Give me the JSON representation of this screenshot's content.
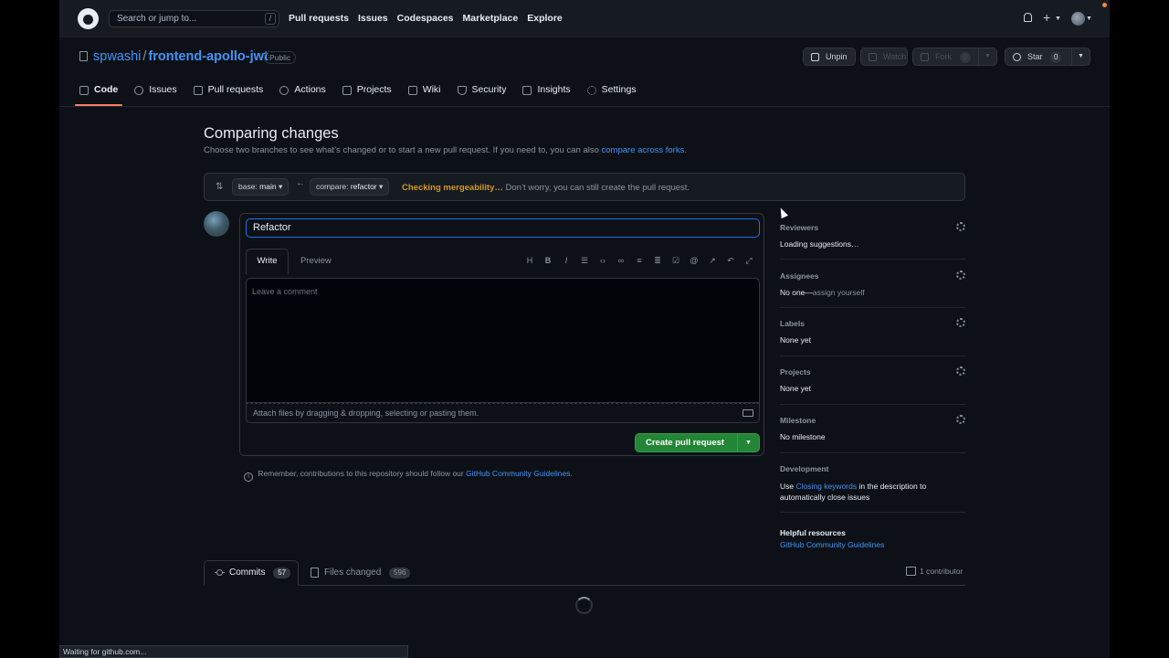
{
  "header": {
    "search_placeholder": "Search or jump to...",
    "slash_key": "/",
    "nav": [
      "Pull requests",
      "Issues",
      "Codespaces",
      "Marketplace",
      "Explore"
    ]
  },
  "repo": {
    "owner": "spwashi",
    "separator": "/",
    "name": "frontend-apollo-jwt",
    "visibility": "Public",
    "unpin_label": "Unpin",
    "watch_label": "Watch",
    "fork_label": "Fork",
    "fork_count": "0",
    "star_label": "Star",
    "star_count": "0"
  },
  "tabs": [
    {
      "label": "Code",
      "icon": "code-icon"
    },
    {
      "label": "Issues",
      "icon": "issue-icon"
    },
    {
      "label": "Pull requests",
      "icon": "pull-request-icon"
    },
    {
      "label": "Actions",
      "icon": "play-icon"
    },
    {
      "label": "Projects",
      "icon": "table-icon"
    },
    {
      "label": "Wiki",
      "icon": "book-icon"
    },
    {
      "label": "Security",
      "icon": "shield-icon"
    },
    {
      "label": "Insights",
      "icon": "graph-icon"
    },
    {
      "label": "Settings",
      "icon": "gear-icon"
    }
  ],
  "compare": {
    "title": "Comparing changes",
    "subtitle": "Choose two branches to see what’s changed or to start a new pull request. If you need to, you can also",
    "subtitle_link": "compare across forks.",
    "base_prefix": "base:",
    "base_branch": "main",
    "compare_prefix": "compare:",
    "compare_branch": "refactor",
    "checking_label": "Checking mergeability…",
    "checking_note": "Don’t worry, you can still create the pull request."
  },
  "form": {
    "title_value": "Refactor",
    "write_tab": "Write",
    "preview_tab": "Preview",
    "toolbar_icons": [
      "heading-icon",
      "bold-icon",
      "italic-icon",
      "quote-icon",
      "code-icon",
      "link-icon",
      "unordered-list-icon",
      "ordered-list-icon",
      "task-list-icon",
      "mention-icon",
      "cross-reference-icon",
      "reply-icon",
      "fullscreen-icon"
    ],
    "comment_placeholder": "Leave a comment",
    "attach_text": "Attach files by dragging & dropping, selecting or pasting them.",
    "create_label": "Create pull request",
    "guidelines_text": "Remember, contributions to this repository should follow our",
    "guidelines_link": "GitHub Community Guidelines."
  },
  "sidebar": {
    "reviewers": {
      "heading": "Reviewers",
      "value": "Loading suggestions…"
    },
    "assignees": {
      "heading": "Assignees",
      "value": "No one—",
      "link": "assign yourself"
    },
    "labels": {
      "heading": "Labels",
      "value": "None yet"
    },
    "projects": {
      "heading": "Projects",
      "value": "None yet"
    },
    "milestone": {
      "heading": "Milestone",
      "value": "No milestone"
    },
    "development": {
      "heading": "Development",
      "text_before": "Use",
      "link": "Closing keywords",
      "text_after": "in the description to automatically close issues"
    },
    "helpful": {
      "heading": "Helpful resources",
      "link": "GitHub Community Guidelines"
    }
  },
  "bottom": {
    "commits_label": "Commits",
    "commits_count": "57",
    "files_label": "Files changed",
    "files_count": "596",
    "contributors": "1 contributor"
  },
  "status_bar": "Waiting for github.com...",
  "colors": {
    "accent": "#4493f8",
    "create_button": "#238636",
    "checking": "#d29922",
    "active_tab": "#f78166"
  }
}
